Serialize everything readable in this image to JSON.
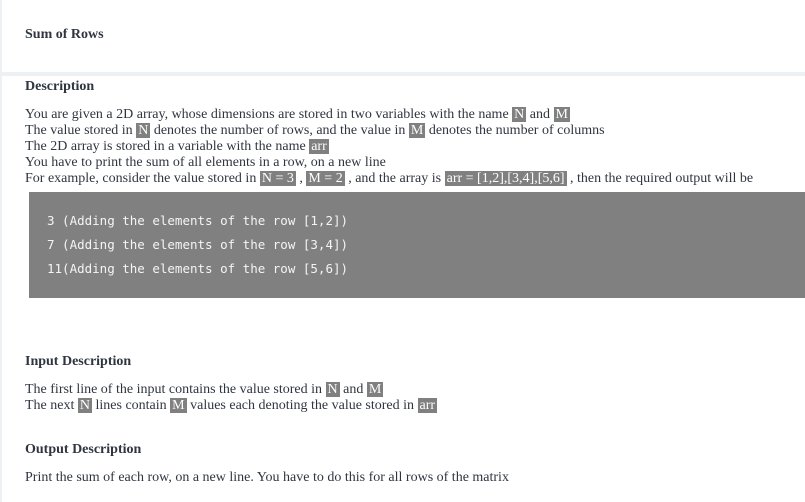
{
  "title": "Sum of Rows",
  "description": {
    "heading": "Description",
    "lines": [
      [
        {
          "t": "You are given a 2D array, whose dimensions are stored in two variables with the name "
        },
        {
          "c": "N"
        },
        {
          "t": " and "
        },
        {
          "c": "M"
        }
      ],
      [
        {
          "t": "The value stored in "
        },
        {
          "c": "N"
        },
        {
          "t": " denotes the number of rows, and the value in "
        },
        {
          "c": "M"
        },
        {
          "t": " denotes the number of columns"
        }
      ],
      [
        {
          "t": "The 2D array is stored in a variable with the name "
        },
        {
          "c": "arr"
        }
      ],
      [
        {
          "t": "You have to print the sum of all elements in a row, on a new line"
        }
      ],
      [
        {
          "t": "For example, consider the value stored in "
        },
        {
          "c": "N = 3"
        },
        {
          "t": " , "
        },
        {
          "c": "M = 2"
        },
        {
          "t": " , and the array is "
        },
        {
          "c": "arr = [1,2],[3,4],[5,6]"
        },
        {
          "t": " , then the required output will be"
        }
      ]
    ],
    "code_lines": [
      "3 (Adding the elements of the row [1,2])",
      "7 (Adding the elements of the row [3,4])",
      "11(Adding the elements of the row [5,6])"
    ]
  },
  "input": {
    "heading": "Input Description",
    "lines": [
      [
        {
          "t": "The first line of the input contains the value stored in "
        },
        {
          "c": "N"
        },
        {
          "t": " and "
        },
        {
          "c": "M"
        }
      ],
      [
        {
          "t": "The next "
        },
        {
          "c": "N"
        },
        {
          "t": " lines contain "
        },
        {
          "c": "M"
        },
        {
          "t": " values each denoting the value stored in "
        },
        {
          "c": "arr"
        }
      ]
    ]
  },
  "output": {
    "heading": "Output Description",
    "lines": [
      [
        {
          "t": "Print the sum of each row, on a new line. You have to do this for all rows of the matrix"
        }
      ]
    ]
  }
}
